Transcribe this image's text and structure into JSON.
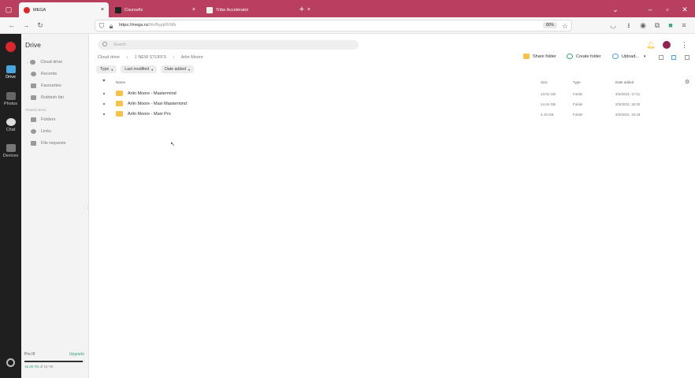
{
  "browser": {
    "tabs": [
      {
        "title": "MEGA",
        "active": true
      },
      {
        "title": "Coursefix",
        "active": false
      },
      {
        "title": "Tribe Accelerator",
        "active": false
      }
    ],
    "new_tab": "+",
    "close_glyph": "×",
    "url_host": "https://mega.nz",
    "url_path": "/fm/fkgqRKMb",
    "zoom": "80%"
  },
  "rail": [
    {
      "label": "Drive",
      "active": true
    },
    {
      "label": "Photos",
      "active": false
    },
    {
      "label": "Chat",
      "active": false
    },
    {
      "label": "Devices",
      "active": false
    }
  ],
  "sidebar": {
    "title": "Drive",
    "items": [
      "Cloud drive",
      "Recents",
      "Favourites",
      "Rubbish bin"
    ],
    "shared_section": "Shared items",
    "shared_items": [
      "Folders",
      "Links",
      "File requests"
    ],
    "storage": {
      "plan": "Pro III",
      "upgrade": "Upgrade",
      "used": "16.30 TB",
      "total": "of 16 TB",
      "fill_fraction": 0.98
    }
  },
  "main": {
    "search_placeholder": "Search",
    "breadcrumb": [
      "Cloud drive",
      "1 NEW STUFFS",
      "Arlin Moore"
    ],
    "actions": {
      "share": "Share folder",
      "create": "Create folder",
      "upload": "Upload..."
    },
    "filters": [
      "Type",
      "Last modified",
      "Date added"
    ],
    "columns": {
      "name": "Name",
      "size": "Size",
      "type": "Type",
      "date": "Date added"
    },
    "rows": [
      {
        "name": "Arlin Moore - Mastermind",
        "size": "13.01 GB",
        "type": "Folder",
        "date": "3/3/2023, 17:31"
      },
      {
        "name": "Arlin Moore - Maxi Mastermind",
        "size": "14.04 GB",
        "type": "Folder",
        "date": "3/3/2023, 18:30"
      },
      {
        "name": "Arlin Moore - Maxi Pro",
        "size": "4.15 GB",
        "type": "Folder",
        "date": "3/3/2023, 19:18"
      }
    ]
  },
  "colors": {
    "brand": "#d9272e",
    "chrome": "#b8405e",
    "folder": "#f4c34b",
    "accent_green": "#3aa67a"
  }
}
